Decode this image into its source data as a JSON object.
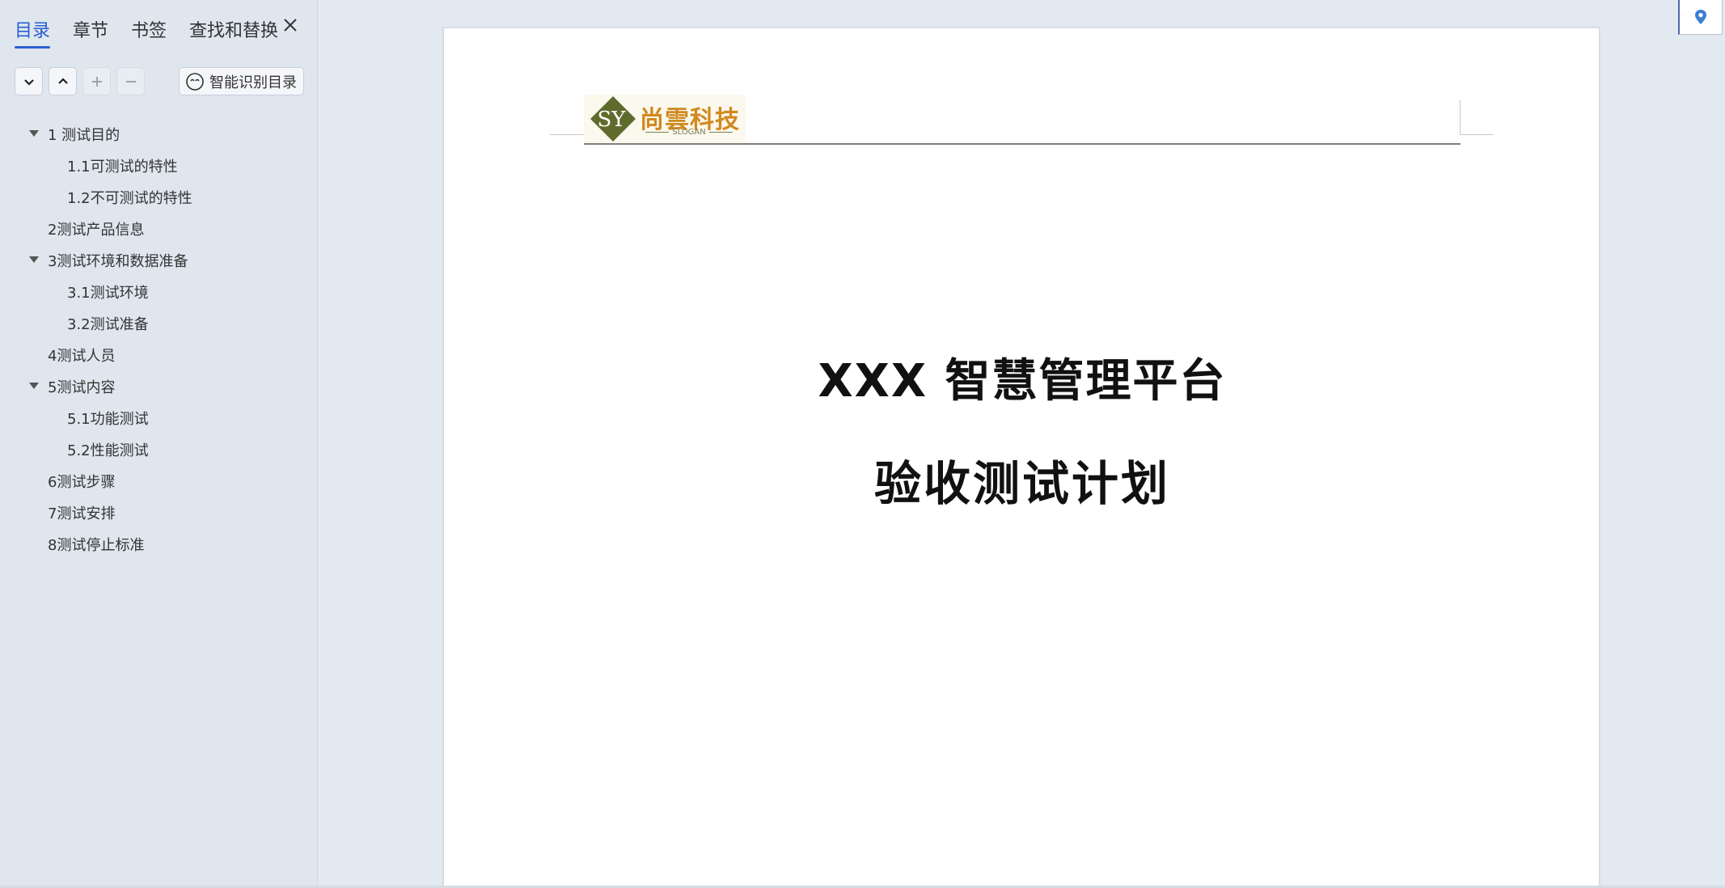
{
  "sidebar": {
    "tabs": [
      {
        "label": "目录",
        "active": true
      },
      {
        "label": "章节",
        "active": false
      },
      {
        "label": "书签",
        "active": false
      },
      {
        "label": "查找和替换",
        "active": false
      }
    ],
    "toolbar": {
      "expand_icon": "chevron-down-icon",
      "collapse_icon": "chevron-up-icon",
      "add_icon": "plus-icon",
      "remove_icon": "minus-icon",
      "smart_label": "智能识别目录"
    },
    "toc": [
      {
        "label": "1 测试目的",
        "level": 1,
        "expanded": true
      },
      {
        "label": "1.1可测试的特性",
        "level": 2
      },
      {
        "label": "1.2不可测试的特性",
        "level": 2
      },
      {
        "label": "2测试产品信息",
        "level": 1
      },
      {
        "label": "3测试环境和数据准备",
        "level": 1,
        "expanded": true
      },
      {
        "label": "3.1测试环境",
        "level": 2
      },
      {
        "label": "3.2测试准备",
        "level": 2
      },
      {
        "label": "4测试人员",
        "level": 1
      },
      {
        "label": "5测试内容",
        "level": 1,
        "expanded": true
      },
      {
        "label": "5.1功能测试",
        "level": 2
      },
      {
        "label": "5.2性能测试",
        "level": 2
      },
      {
        "label": "6测试步骤",
        "level": 1
      },
      {
        "label": "7测试安排",
        "level": 1
      },
      {
        "label": "8测试停止标准",
        "level": 1
      }
    ]
  },
  "document": {
    "logo": {
      "initials": "SY",
      "name": "尚雲科技",
      "slogan": "SLOGAN",
      "colors": {
        "diamond": "#5f6b2c",
        "text": "#d08a1f"
      }
    },
    "title_line1": "XXX 智慧管理平台",
    "title_line2": "验收测试计划"
  },
  "colors": {
    "accent": "#2b5fd1",
    "sidebar_bg": "#dfe6ee",
    "workspace_bg": "#e3e9f1"
  }
}
